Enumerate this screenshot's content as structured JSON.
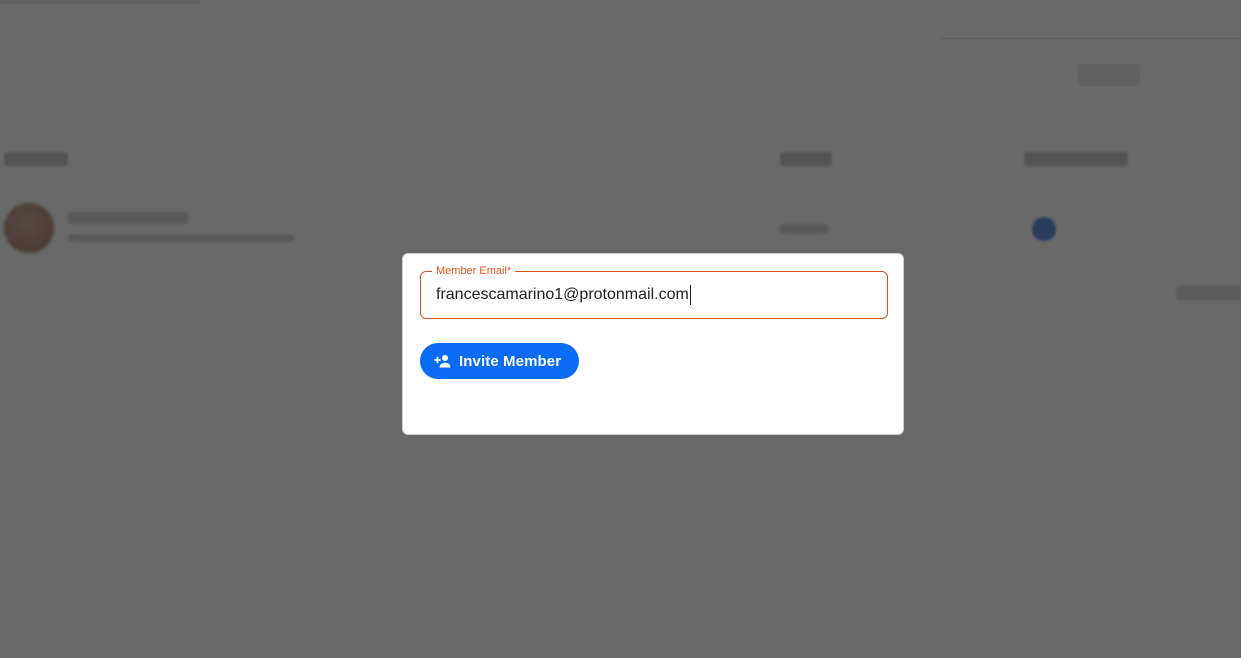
{
  "modal": {
    "email_label": "Member Email*",
    "email_value": "francescamarino1@protonmail.com",
    "invite_button_label": "Invite Member",
    "invite_button_icon": "person-add-icon"
  },
  "colors": {
    "accent": "#0a6cf5",
    "field_border": "#d9531e",
    "label": "#e0541f",
    "overlay": "rgba(40,40,42,0.7)"
  }
}
